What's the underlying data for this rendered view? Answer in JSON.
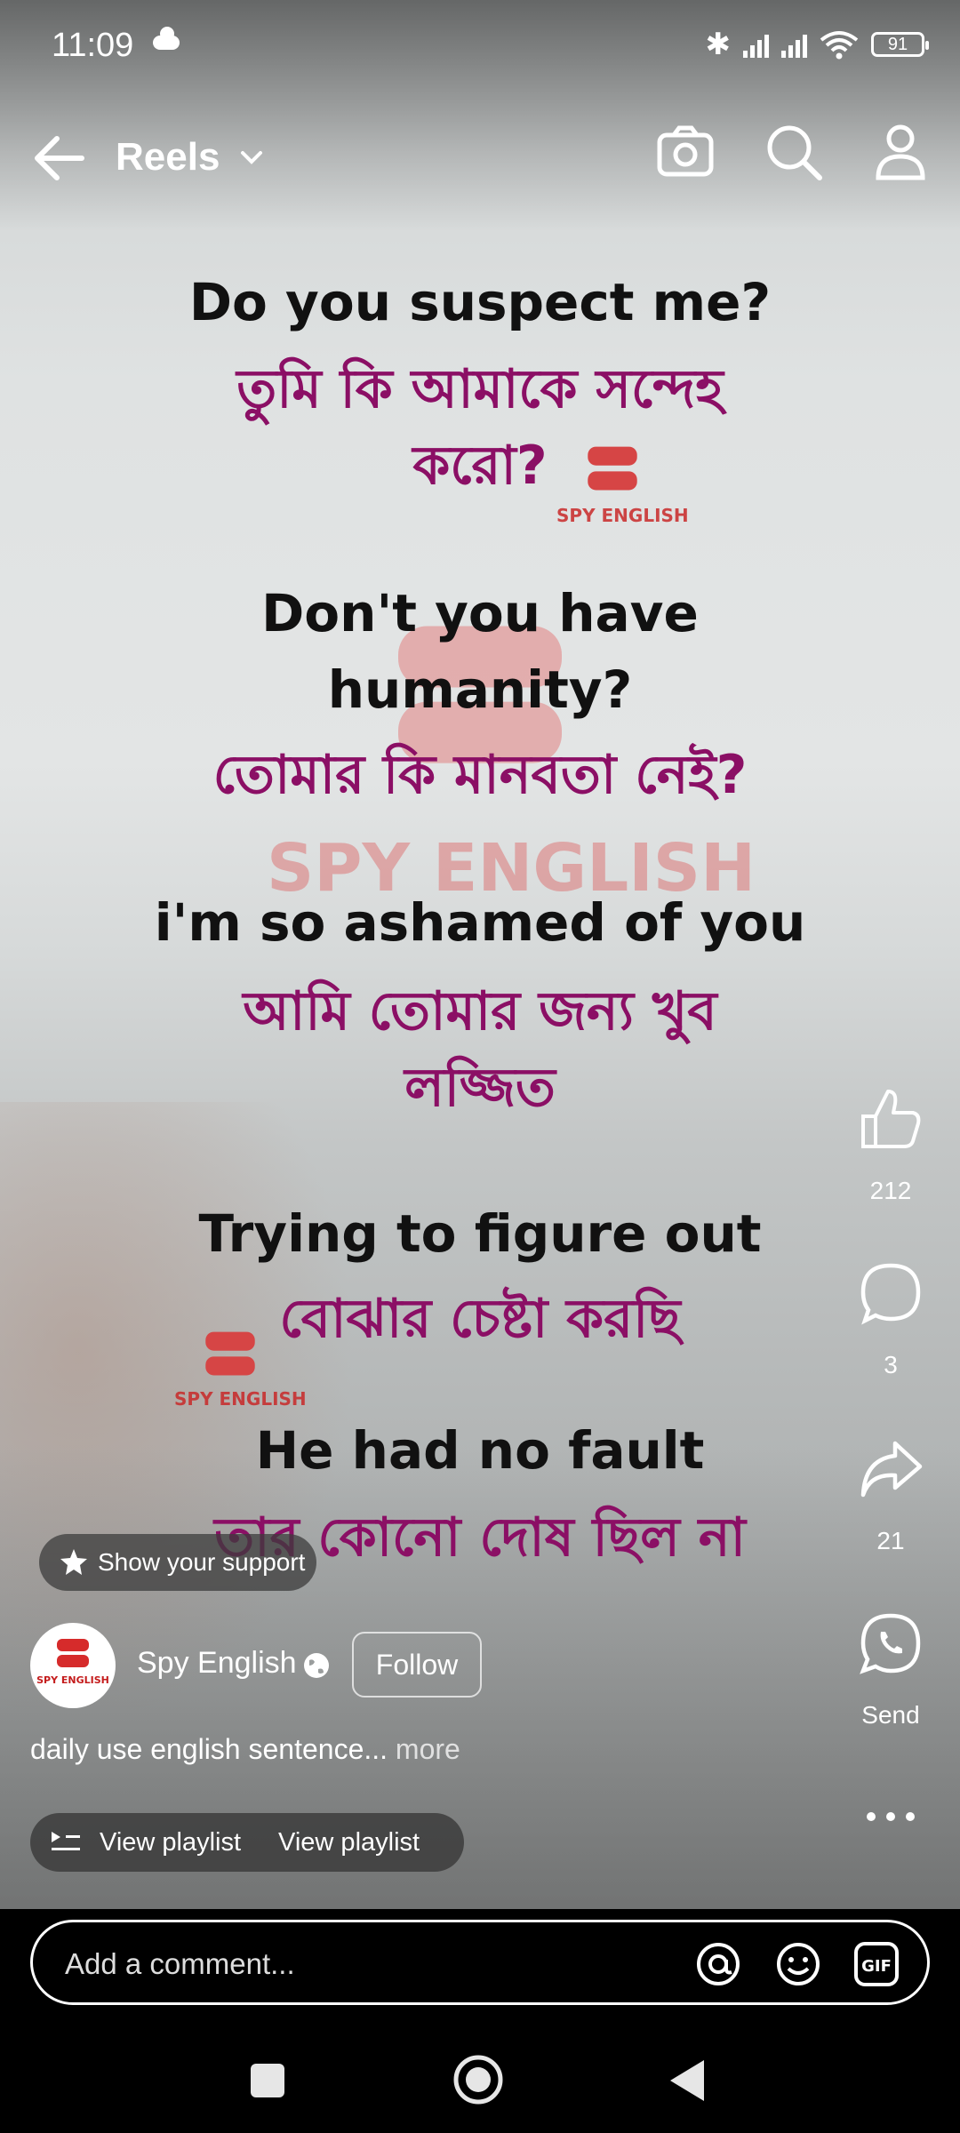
{
  "status_bar": {
    "time": "11:09",
    "battery": "91"
  },
  "header": {
    "title": "Reels"
  },
  "overlay_text": {
    "line1_en": "Do you suspect me?",
    "line1_bn_a": "তুমি কি আমাকে সন্দেহ",
    "line1_bn_b": "করো?",
    "line2_en_a": "Don't you have",
    "line2_en_b": "humanity?",
    "line2_bn": "তোমার কি মানবতা নেই?",
    "line3_en": "i'm so ashamed of you",
    "line3_bn_a": "আমি তোমার জন্য খুব",
    "line3_bn_b": "লজ্জিত",
    "line4_en": "Trying to figure out",
    "line4_bn": "বোঝার চেষ্টা করছি",
    "line5_en": "He had no fault",
    "line5_bn": "তার কোনো দোষ ছিল না",
    "watermark_big": "SPY ENGLISH",
    "watermark_small": "SPY ENGLISH"
  },
  "actions": {
    "likes": "212",
    "comments": "3",
    "shares": "21",
    "send_label": "Send"
  },
  "post": {
    "support_label": "Show your support",
    "avatar_text": "SPY ENGLISH",
    "author": "Spy English",
    "follow_label": "Follow",
    "caption": "daily use english sentence...",
    "more_label": " more",
    "playlist_label_1": "View playlist",
    "playlist_label_2": "View playlist"
  },
  "comment_bar": {
    "placeholder": "Add a comment..."
  },
  "icons": [
    "back-arrow-icon",
    "chevron-down-icon",
    "camera-icon",
    "search-icon",
    "profile-icon",
    "like-icon",
    "comment-icon",
    "share-icon",
    "whatsapp-icon",
    "more-icon",
    "star-icon",
    "globe-icon",
    "playlist-icon",
    "mention-icon",
    "emoji-icon",
    "gif-icon",
    "recents-icon",
    "home-icon",
    "back-icon"
  ],
  "colors": {
    "bengali_text": "#8b0f65",
    "english_text": "#111111",
    "watermark": "#c82828"
  }
}
